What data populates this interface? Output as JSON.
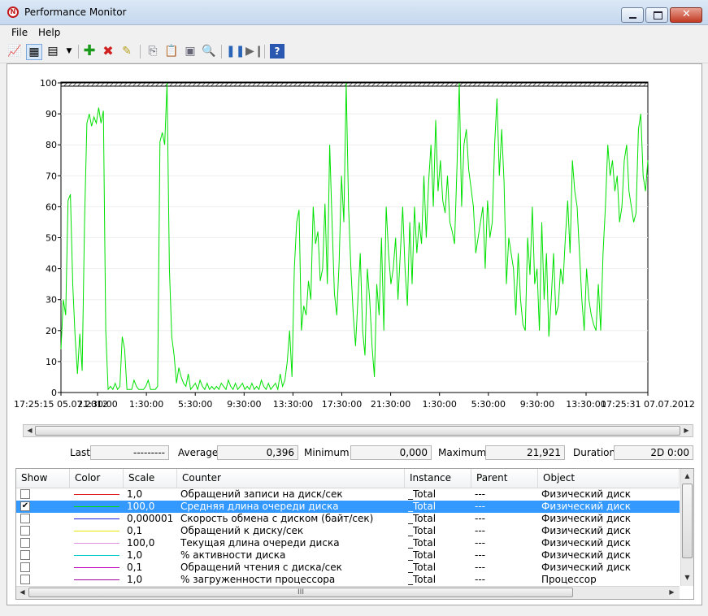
{
  "window": {
    "title": "Performance Monitor"
  },
  "menu": [
    {
      "label": "File"
    },
    {
      "label": "Help"
    }
  ],
  "toolbar_icons": [
    "view-graph-icon",
    "view-histogram-icon",
    "view-report-icon",
    "change-graph-type-icon",
    "add-counter-icon",
    "delete-counter-icon",
    "highlight-icon",
    "copy-properties-icon",
    "paste-counter-list-icon",
    "properties-icon",
    "zoom-icon",
    "freeze-display-icon",
    "update-data-icon",
    "help-icon"
  ],
  "chart_data": {
    "type": "line",
    "y_ticks": [
      "100",
      "90",
      "80",
      "70",
      "60",
      "50",
      "40",
      "30",
      "20",
      "10",
      "0"
    ],
    "ylim": [
      0,
      100
    ],
    "x_ticks": [
      "17:25:15 05.07.2012",
      "21:30:00",
      "1:30:00",
      "5:30:00",
      "9:30:00",
      "13:30:00",
      "17:30:00",
      "21:30:00",
      "1:30:00",
      "5:30:00",
      "9:30:00",
      "13:30:00",
      "17:25:31 07.07.2012"
    ],
    "grid": true,
    "series": [
      {
        "color": "#00e000",
        "values": [
          14,
          30,
          25,
          62,
          64,
          35,
          18,
          6,
          19,
          7,
          55,
          87,
          90,
          86,
          89,
          87,
          92,
          87,
          91,
          20,
          1,
          2,
          1,
          3,
          1,
          2,
          18,
          14,
          1,
          1,
          1,
          4,
          2,
          1,
          1,
          1,
          2,
          4,
          1,
          1,
          1,
          2,
          81,
          84,
          80,
          100,
          40,
          18,
          12,
          3,
          8,
          5,
          3,
          2,
          6,
          1,
          2,
          3,
          1,
          4,
          2,
          1,
          3,
          1,
          2,
          1,
          2,
          1,
          3,
          2,
          1,
          4,
          2,
          1,
          3,
          1,
          2,
          3,
          1,
          2,
          1,
          3,
          1,
          2,
          1,
          4,
          2,
          1,
          3,
          1,
          2,
          3,
          1,
          6,
          2,
          4,
          10,
          20,
          5,
          40,
          55,
          59,
          20,
          28,
          25,
          36,
          30,
          60,
          48,
          52,
          36,
          40,
          61,
          35,
          80,
          55,
          32,
          25,
          42,
          70,
          55,
          100,
          60,
          40,
          25,
          15,
          30,
          45,
          20,
          12,
          40,
          30,
          15,
          5,
          35,
          25,
          50,
          20,
          60,
          45,
          35,
          40,
          50,
          30,
          45,
          60,
          40,
          28,
          55,
          35,
          60,
          45,
          55,
          48,
          70,
          50,
          68,
          80,
          60,
          88,
          65,
          75,
          62,
          58,
          70,
          55,
          52,
          48,
          72,
          100,
          60,
          80,
          85,
          72,
          66,
          60,
          45,
          50,
          55,
          60,
          40,
          62,
          50,
          55,
          80,
          95,
          70,
          85,
          68,
          35,
          50,
          45,
          40,
          25,
          45,
          30,
          22,
          20,
          50,
          38,
          60,
          35,
          40,
          20,
          55,
          30,
          45,
          18,
          30,
          45,
          25,
          28,
          40,
          35,
          50,
          62,
          45,
          75,
          65,
          60,
          45,
          30,
          20,
          40,
          30,
          25,
          22,
          20,
          35,
          20,
          45,
          60,
          80,
          70,
          75,
          65,
          70,
          55,
          60,
          75,
          80,
          65,
          60,
          55,
          58,
          85,
          90,
          70,
          65,
          75
        ]
      }
    ]
  },
  "scroll": {
    "left_icon": "scroll-left-icon",
    "right_icon": "scroll-right-icon"
  },
  "stats": {
    "last_label": "Last",
    "last_value": "---------",
    "avg_label": "Average",
    "avg_value": "0,396",
    "min_label": "Minimum",
    "min_value": "0,000",
    "max_label": "Maximum",
    "max_value": "21,921",
    "dur_label": "Duration",
    "dur_value": "2D 0:00"
  },
  "table": {
    "headers": [
      "Show",
      "Color",
      "Scale",
      "Counter",
      "Instance",
      "Parent",
      "Object"
    ],
    "rows": [
      {
        "checked": false,
        "color": "#e02020",
        "scale": "1,0",
        "counter": "Обращений записи на диск/сек",
        "instance": "_Total",
        "parent": "---",
        "object": "Физический диск",
        "selected": false
      },
      {
        "checked": true,
        "color": "#00e000",
        "scale": "100,0",
        "counter": "Средняя длина очереди диска",
        "instance": "_Total",
        "parent": "---",
        "object": "Физический диск",
        "selected": true
      },
      {
        "checked": false,
        "color": "#2020e0",
        "scale": "0,000001",
        "counter": "Скорость обмена с диском (байт/сек)",
        "instance": "_Total",
        "parent": "---",
        "object": "Физический диск",
        "selected": false
      },
      {
        "checked": false,
        "color": "#e8e800",
        "scale": "0,1",
        "counter": "Обращений к диску/сек",
        "instance": "_Total",
        "parent": "---",
        "object": "Физический диск",
        "selected": false
      },
      {
        "checked": false,
        "color": "#e090e0",
        "scale": "100,0",
        "counter": "Текущая длина очереди диска",
        "instance": "_Total",
        "parent": "---",
        "object": "Физический диск",
        "selected": false
      },
      {
        "checked": false,
        "color": "#00c8c8",
        "scale": "1,0",
        "counter": "% активности диска",
        "instance": "_Total",
        "parent": "---",
        "object": "Физический диск",
        "selected": false
      },
      {
        "checked": false,
        "color": "#c000c0",
        "scale": "0,1",
        "counter": "Обращений чтения с диска/сек",
        "instance": "_Total",
        "parent": "---",
        "object": "Физический диск",
        "selected": false
      },
      {
        "checked": false,
        "color": "#a000a0",
        "scale": "1,0",
        "counter": "% загруженности процессора",
        "instance": "_Total",
        "parent": "---",
        "object": "Процессор",
        "selected": false
      }
    ],
    "hscroll_grip": "III"
  }
}
